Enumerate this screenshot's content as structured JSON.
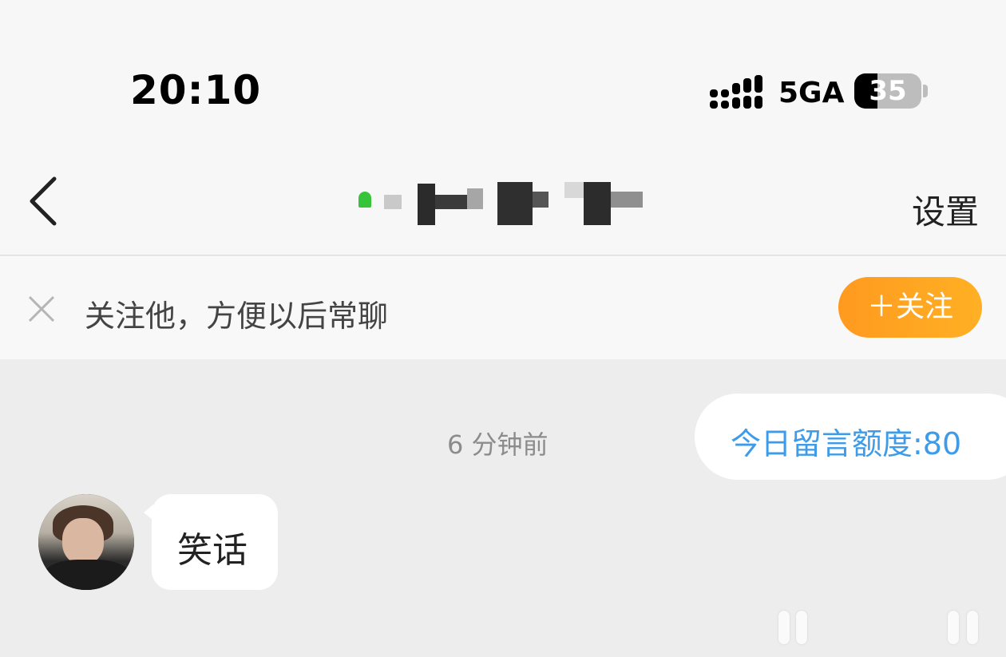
{
  "status_bar": {
    "time": "20:10",
    "network": "5GA",
    "battery": "35",
    "battery_level": 0.35,
    "icons": [
      "signal-icon",
      "battery-icon"
    ]
  },
  "nav": {
    "back_icon": "chevron-left-icon",
    "title_redacted": true,
    "settings_label": "设置"
  },
  "follow_banner": {
    "close_icon": "close-icon",
    "text": "关注他，方便以后常聊",
    "follow_button_label": "＋关注",
    "accent_color": "#ffa11f"
  },
  "chat": {
    "timestamp": "6 分钟前",
    "quota_text": "今日留言额度:80",
    "quota_color": "#3d9be9",
    "messages": [
      {
        "sender": "other",
        "text": "笑话"
      }
    ]
  }
}
